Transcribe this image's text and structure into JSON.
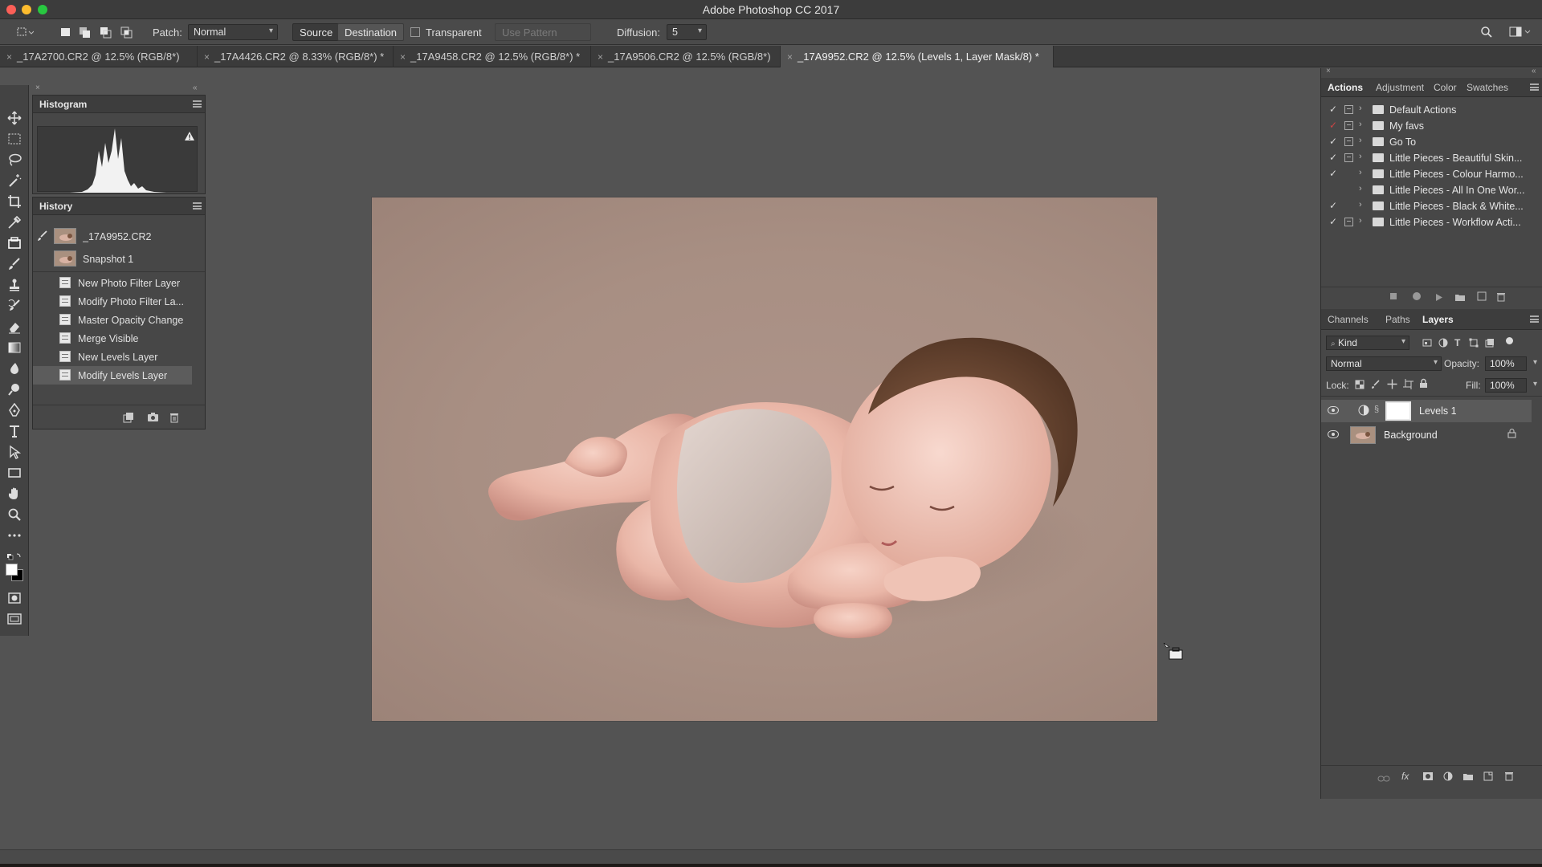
{
  "app": {
    "title": "Adobe Photoshop CC 2017"
  },
  "options_bar": {
    "patch_label": "Patch:",
    "patch_mode": "Normal",
    "source_label": "Source",
    "destination_label": "Destination",
    "transparent_label": "Transparent",
    "use_pattern_label": "Use Pattern",
    "diffusion_label": "Diffusion:",
    "diffusion_value": "5"
  },
  "tabs": [
    {
      "label": "_17A2700.CR2 @ 12.5% (RGB/8*)"
    },
    {
      "label": "_17A4426.CR2 @ 8.33% (RGB/8*) *"
    },
    {
      "label": "_17A9458.CR2 @ 12.5% (RGB/8*) *"
    },
    {
      "label": "_17A9506.CR2 @ 12.5% (RGB/8*)"
    },
    {
      "label": "_17A9952.CR2 @ 12.5% (Levels 1, Layer Mask/8) *"
    }
  ],
  "histogram_panel": {
    "title": "Histogram"
  },
  "history_panel": {
    "title": "History",
    "snapshots": [
      {
        "label": "_17A9952.CR2"
      },
      {
        "label": "Snapshot 1"
      }
    ],
    "states": [
      {
        "label": "New Photo Filter Layer"
      },
      {
        "label": "Modify Photo Filter La..."
      },
      {
        "label": "Master Opacity Change"
      },
      {
        "label": "Merge Visible"
      },
      {
        "label": "New Levels Layer"
      },
      {
        "label": "Modify Levels Layer"
      }
    ]
  },
  "actions_panel": {
    "tabs": [
      {
        "label": "Actions"
      },
      {
        "label": "Adjustment"
      },
      {
        "label": "Color"
      },
      {
        "label": "Swatches"
      }
    ],
    "items": [
      {
        "name": "Default Actions",
        "checked": true
      },
      {
        "name": "My favs",
        "checked": true
      },
      {
        "name": "Go To",
        "checked": true
      },
      {
        "name": "Little Pieces - Beautiful Skin...",
        "checked": true
      },
      {
        "name": "Little Pieces - Colour Harmo...",
        "checked": true
      },
      {
        "name": "Little Pieces - All In One Wor...",
        "checked": false
      },
      {
        "name": "Little Pieces - Black & White...",
        "checked": true
      },
      {
        "name": "Little Pieces - Workflow Acti...",
        "checked": true
      }
    ]
  },
  "layers_panel": {
    "tabs": [
      {
        "label": "Channels"
      },
      {
        "label": "Paths"
      },
      {
        "label": "Layers"
      }
    ],
    "filter_kind": "Kind",
    "blend_mode": "Normal",
    "opacity_label": "Opacity:",
    "opacity_value": "100%",
    "lock_label": "Lock:",
    "fill_label": "Fill:",
    "fill_value": "100%",
    "layers": [
      {
        "name": "Levels 1"
      },
      {
        "name": "Background"
      }
    ]
  },
  "colors": {
    "canvas_bg": "#535353",
    "photo_backdrop": "#a88f83",
    "panel_bg": "#474747"
  }
}
